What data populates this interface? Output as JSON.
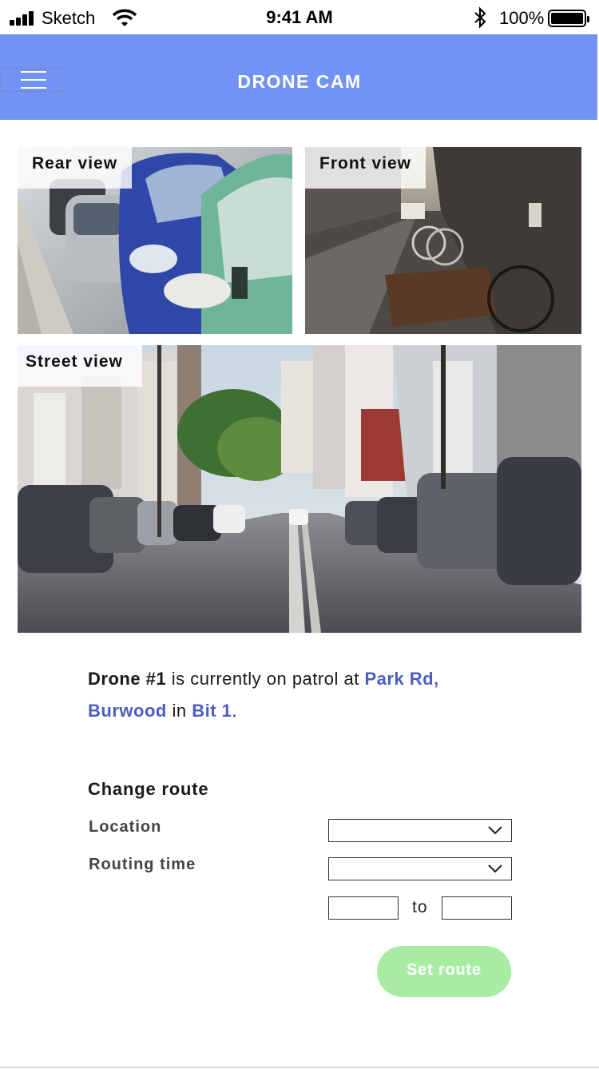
{
  "status_bar": {
    "carrier": "Sketch",
    "time": "9:41 AM",
    "battery_percent": "100%",
    "icons": [
      "signal-icon",
      "wifi-icon",
      "bluetooth-icon",
      "battery-icon"
    ]
  },
  "header": {
    "title": "DRONE CAM",
    "menu_icon": "hamburger-menu-icon",
    "background_color": "#7393f4"
  },
  "cameras": {
    "rear": {
      "label": "Rear view"
    },
    "front": {
      "label": "Front view"
    },
    "street": {
      "label": "Street view"
    }
  },
  "info": {
    "drone": "Drone #1",
    "text_1": " is currently on patrol at ",
    "location": "Park Rd, Burwood",
    "text_2": " in ",
    "area": "Bit 1",
    "text_3": ".",
    "link_color": "#4a5fbf"
  },
  "form": {
    "title": "Change route",
    "location_label": "Location",
    "location_value": "",
    "routing_time_label": "Routing time",
    "routing_time_value": "",
    "from_value": "",
    "to_label": "to",
    "to_value": "",
    "submit_label": "Set route",
    "submit_color": "#a8eca4"
  }
}
